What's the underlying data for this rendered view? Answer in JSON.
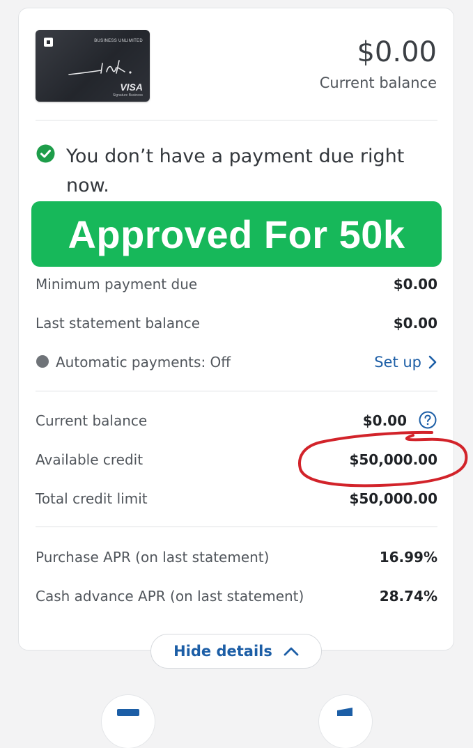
{
  "card": {
    "tier": "BUSINESS UNLIMITED",
    "brand_script": "ink.",
    "network": "VISA",
    "network_sub": "Signature Business"
  },
  "balance_header": {
    "amount": "$0.00",
    "label": "Current balance"
  },
  "payment_status": "You don’t have a payment due right now.",
  "banner": "Approved For 50k",
  "payment_rows": [
    {
      "label": "Minimum payment due",
      "value": "$0.00"
    },
    {
      "label": "Last statement balance",
      "value": "$0.00"
    }
  ],
  "autopay": {
    "label": "Automatic payments: Off",
    "action": "Set up"
  },
  "credit_rows": [
    {
      "label": "Current balance",
      "value": "$0.00"
    },
    {
      "label": "Available credit",
      "value": "$50,000.00"
    },
    {
      "label": "Total credit limit",
      "value": "$50,000.00"
    }
  ],
  "apr_rows": [
    {
      "label": "Purchase APR (on last statement)",
      "value": "16.99%"
    },
    {
      "label": "Cash advance APR (on last statement)",
      "value": "28.74%"
    }
  ],
  "hide_details": "Hide details",
  "colors": {
    "accent_blue": "#1c5ea6",
    "banner_green": "#17b85a",
    "check_green": "#1e9d4a",
    "annotation_red": "#d2232a"
  }
}
